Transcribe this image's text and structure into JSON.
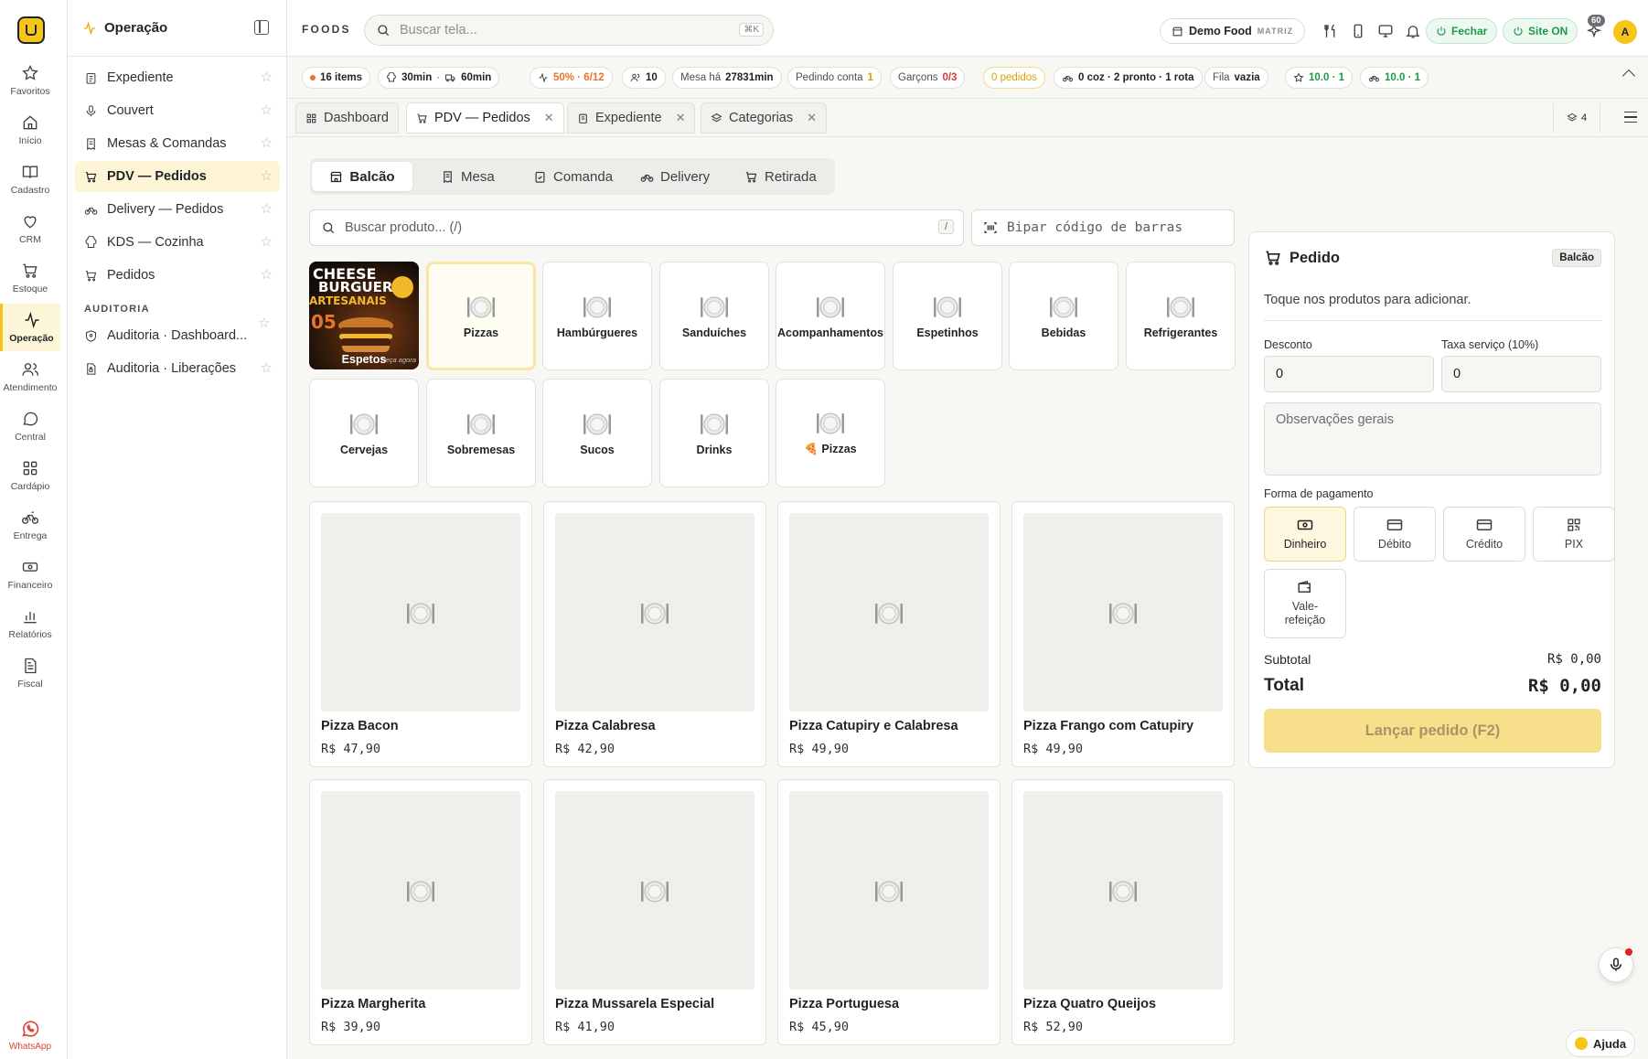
{
  "rail": {
    "items": [
      {
        "label": "Favoritos",
        "icon": "star-icon"
      },
      {
        "label": "Início",
        "icon": "home-icon"
      },
      {
        "label": "Cadastro",
        "icon": "book-icon"
      },
      {
        "label": "CRM",
        "icon": "heart-icon"
      },
      {
        "label": "Estoque",
        "icon": "cart-icon"
      },
      {
        "label": "Operação",
        "icon": "activity-icon"
      },
      {
        "label": "Atendimento",
        "icon": "users-icon"
      },
      {
        "label": "Central",
        "icon": "chat-icon"
      },
      {
        "label": "Cardápio",
        "icon": "grid-icon"
      },
      {
        "label": "Entrega",
        "icon": "bike-icon"
      },
      {
        "label": "Financeiro",
        "icon": "cash-icon"
      },
      {
        "label": "Relatórios",
        "icon": "bar-chart-icon"
      },
      {
        "label": "Fiscal",
        "icon": "document-icon"
      }
    ],
    "whatsapp": "WhatsApp"
  },
  "sidebar": {
    "title": "Operação",
    "items": [
      {
        "label": "Expediente"
      },
      {
        "label": "Couvert"
      },
      {
        "label": "Mesas & Comandas"
      },
      {
        "label": "PDV — Pedidos"
      },
      {
        "label": "Delivery — Pedidos"
      },
      {
        "label": "KDS — Cozinha"
      },
      {
        "label": "Pedidos"
      }
    ],
    "section": "AUDITORIA",
    "audit_items": [
      {
        "label": "Auditoria · Dashboard..."
      },
      {
        "label": "Auditoria · Liberações"
      }
    ]
  },
  "topbar": {
    "brand": "FOODS",
    "search_placeholder": "Buscar tela...",
    "search_kbd": "⌘K",
    "tenant": "Demo Food",
    "tenant_tag": "MATRIZ",
    "close_label": "Fechar",
    "site_label": "Site ON",
    "notif_count": "60",
    "avatar": "A"
  },
  "status": {
    "items": "16 items",
    "prep": "30min",
    "delivery": "60min",
    "load": "50% · 6/12",
    "people": "10",
    "table_label": "Mesa há",
    "table_value": "27831min",
    "bill_label": "Pedindo conta",
    "bill_value": "1",
    "waiters_label": "Garçons",
    "waiters_value": "0/3",
    "orders": "0 pedidos",
    "kitchen": "0 coz · 2 pronto · 1 rota",
    "queue_label": "Fila",
    "queue_value": "vazia",
    "rating1": "10.0 · 1",
    "rating2": "10.0 · 1"
  },
  "tabs": [
    {
      "label": "Dashboard"
    },
    {
      "label": "PDV — Pedidos"
    },
    {
      "label": "Expediente"
    },
    {
      "label": "Categorias"
    }
  ],
  "tabs_count": "4",
  "modes": [
    {
      "label": "Balcão"
    },
    {
      "label": "Mesa"
    },
    {
      "label": "Comanda"
    },
    {
      "label": "Delivery"
    },
    {
      "label": "Retirada"
    }
  ],
  "product_search": {
    "placeholder": "Buscar produto...  (/)",
    "kbd": "/"
  },
  "barcode": {
    "placeholder": "Bipar código de barras"
  },
  "categories": [
    {
      "label": "Espetos"
    },
    {
      "label": "Pizzas"
    },
    {
      "label": "Hambúrgueres"
    },
    {
      "label": "Sanduíches"
    },
    {
      "label": "Acompanhamentos"
    },
    {
      "label": "Espetinhos"
    },
    {
      "label": "Bebidas"
    },
    {
      "label": "Refrigerantes"
    },
    {
      "label": "Cervejas"
    },
    {
      "label": "Sobremesas"
    },
    {
      "label": "Sucos"
    },
    {
      "label": "Drinks"
    },
    {
      "label": "🍕 Pizzas"
    }
  ],
  "promo_image": {
    "line1": "CHEESE",
    "line2": "BURGUER",
    "line3": "ARTESANAIS",
    "price": "05",
    "tag": "Peça agora"
  },
  "products": [
    {
      "name": "Pizza Bacon",
      "price": "R$ 47,90"
    },
    {
      "name": "Pizza Calabresa",
      "price": "R$ 42,90"
    },
    {
      "name": "Pizza Catupiry e Calabresa",
      "price": "R$ 49,90"
    },
    {
      "name": "Pizza Frango com Catupiry",
      "price": "R$ 49,90"
    },
    {
      "name": "Pizza Margherita",
      "price": "R$ 39,90"
    },
    {
      "name": "Pizza Mussarela Especial",
      "price": "R$ 41,90"
    },
    {
      "name": "Pizza Portuguesa",
      "price": "R$ 45,90"
    },
    {
      "name": "Pizza Quatro Queijos",
      "price": "R$ 52,90"
    }
  ],
  "order": {
    "title": "Pedido",
    "tag": "Balcão",
    "hint": "Toque nos produtos para adicionar.",
    "discount_label": "Desconto",
    "discount_value": "0",
    "service_label": "Taxa serviço (10%)",
    "service_value": "0",
    "notes_placeholder": "Observações gerais",
    "payment_label": "Forma de pagamento",
    "payments": [
      {
        "label": "Dinheiro"
      },
      {
        "label": "Débito"
      },
      {
        "label": "Crédito"
      },
      {
        "label": "PIX"
      },
      {
        "label": "Vale-refeição"
      }
    ],
    "subtotal_label": "Subtotal",
    "subtotal_value": "R$ 0,00",
    "total_label": "Total",
    "total_value": "R$ 0,00",
    "submit_label": "Lançar pedido (F2)"
  },
  "help_label": "Ajuda",
  "colors": {
    "accent": "#f5c518",
    "green": "#1c9a4a",
    "orange": "#e8742a",
    "red": "#d93b3b"
  }
}
